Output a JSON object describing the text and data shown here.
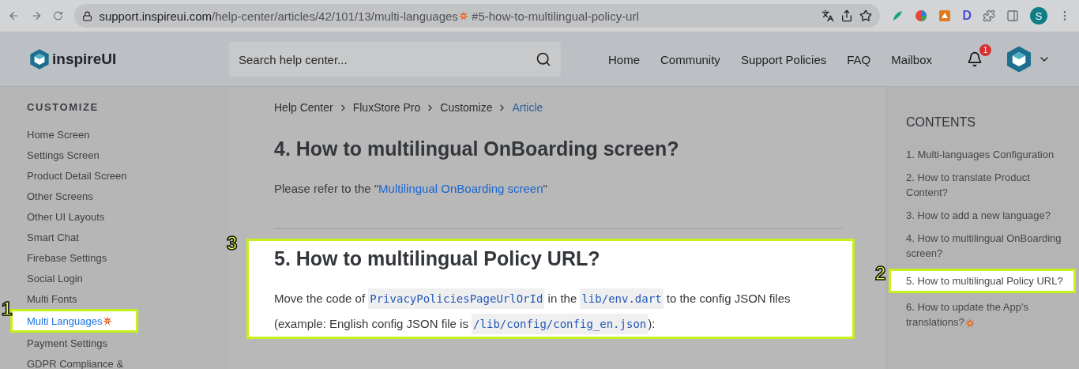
{
  "browser": {
    "url_host": "support.inspireui.com",
    "url_path": "/help-center/articles/42/101/13/multi-languages",
    "url_fragment": "#5-how-to-multilingual-policy-url",
    "extension_letter": "D",
    "profile_letter": "S"
  },
  "header": {
    "logo": "inspireUI",
    "search": {
      "placeholder": "Search help center..."
    },
    "nav": [
      "Home",
      "Community",
      "Support Policies",
      "FAQ",
      "Mailbox"
    ],
    "notification_count": "1"
  },
  "sidebar": {
    "heading": "CUSTOMIZE",
    "items": [
      {
        "label": "Home Screen",
        "selected": false
      },
      {
        "label": "Settings Screen",
        "selected": false
      },
      {
        "label": "Product Detail Screen",
        "selected": false
      },
      {
        "label": "Other Screens",
        "selected": false
      },
      {
        "label": "Other UI Layouts",
        "selected": false
      },
      {
        "label": "Smart Chat",
        "selected": false
      },
      {
        "label": "Firebase Settings",
        "selected": false
      },
      {
        "label": "Social Login",
        "selected": false
      },
      {
        "label": "Multi Fonts",
        "selected": false
      },
      {
        "label": "Multi Languages",
        "selected": true,
        "burst": true,
        "marker": "1"
      },
      {
        "label": "Payment Settings",
        "selected": false
      },
      {
        "label": "GDPR Compliance &",
        "selected": false
      }
    ]
  },
  "breadcrumb": [
    {
      "label": "Help Center",
      "current": false
    },
    {
      "label": "FluxStore Pro",
      "current": false
    },
    {
      "label": "Customize",
      "current": false
    },
    {
      "label": "Article",
      "current": true
    }
  ],
  "sections": [
    {
      "title": "4. How to multilingual OnBoarding screen?",
      "highlighted": false,
      "paragraph": [
        {
          "kind": "text",
          "text": "Please refer to the \""
        },
        {
          "kind": "link",
          "text": "Multilingual OnBoarding screen"
        },
        {
          "kind": "text",
          "text": "\""
        }
      ]
    },
    {
      "title": "5. How to multilingual Policy URL?",
      "highlighted": true,
      "marker": "3",
      "paragraph": [
        {
          "kind": "text",
          "text": "Move the code of "
        },
        {
          "kind": "code",
          "text": "PrivacyPoliciesPageUrlOrId"
        },
        {
          "kind": "text",
          "text": " in the "
        },
        {
          "kind": "code",
          "text": "lib/env.dart"
        },
        {
          "kind": "text",
          "text": " to the config JSON files (example: English config JSON file is "
        },
        {
          "kind": "code",
          "text": "/lib/config/config_en.json"
        },
        {
          "kind": "text",
          "text": "):"
        }
      ]
    }
  ],
  "contents": {
    "heading": "CONTENTS",
    "items": [
      {
        "label": "1. Multi-languages Configuration",
        "selected": false
      },
      {
        "label": "2. How to translate Product Content?",
        "selected": false
      },
      {
        "label": "3. How to add a new language?",
        "selected": false
      },
      {
        "label": "4. How to multilingual OnBoarding screen?",
        "selected": false
      },
      {
        "label": "5. How to multilingual Policy URL?",
        "selected": true,
        "marker": "2"
      },
      {
        "label": "6. How to update the App's translations?",
        "selected": false,
        "burst": true
      }
    ]
  }
}
